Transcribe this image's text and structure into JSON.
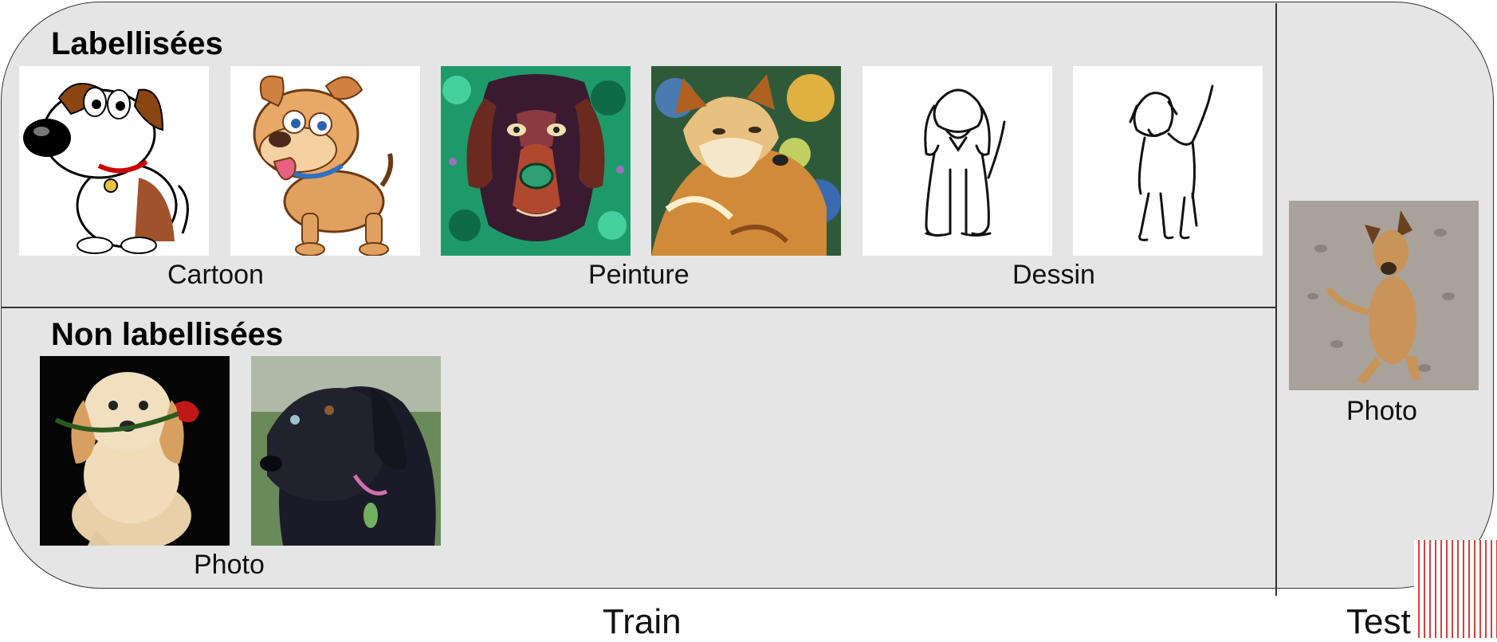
{
  "labelled": {
    "title": "Labellisées",
    "groups": [
      {
        "label": "Cartoon"
      },
      {
        "label": "Peinture"
      },
      {
        "label": "Dessin"
      }
    ]
  },
  "unlabelled": {
    "title": "Non labellisées",
    "groups": [
      {
        "label": "Photo"
      }
    ]
  },
  "test": {
    "groups": [
      {
        "label": "Photo"
      }
    ]
  },
  "footer": {
    "train_label": "Train",
    "test_label": "Test"
  },
  "images": [
    {
      "name": "cartoon-dog-white-brown",
      "domain": "Cartoon"
    },
    {
      "name": "cartoon-dog-orange",
      "domain": "Cartoon"
    },
    {
      "name": "painting-dog-dark-green",
      "domain": "Peinture"
    },
    {
      "name": "painting-dog-fluffy",
      "domain": "Peinture"
    },
    {
      "name": "sketch-dog-sitting",
      "domain": "Dessin"
    },
    {
      "name": "sketch-dog-standing",
      "domain": "Dessin"
    },
    {
      "name": "photo-golden-puppy-rose",
      "domain": "Photo"
    },
    {
      "name": "photo-black-dog",
      "domain": "Photo"
    },
    {
      "name": "photo-tan-dog-sand",
      "domain": "Photo"
    }
  ]
}
